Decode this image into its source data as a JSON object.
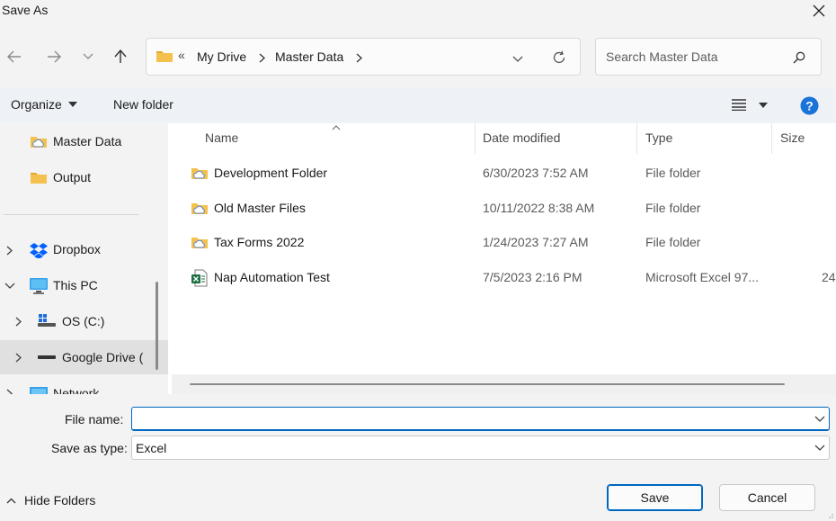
{
  "window": {
    "title": "Save As"
  },
  "address": {
    "crumbs": [
      "My Drive",
      "Master Data"
    ],
    "overflow": "«"
  },
  "search": {
    "placeholder": "Search Master Data"
  },
  "toolbar": {
    "organize_label": "Organize",
    "new_folder_label": "New folder"
  },
  "tree": {
    "items": [
      {
        "label": "Master Data"
      },
      {
        "label": "Output"
      },
      {
        "label": "Dropbox"
      },
      {
        "label": "This PC"
      },
      {
        "label": "OS (C:)"
      },
      {
        "label": "Google Drive ("
      },
      {
        "label": "Network"
      }
    ]
  },
  "files": {
    "columns": [
      "Name",
      "Date modified",
      "Type",
      "Size"
    ],
    "rows": [
      {
        "name": "Development Folder",
        "date": "6/30/2023 7:52 AM",
        "type": "File folder",
        "size": "",
        "icon": "folder-cloud-icon"
      },
      {
        "name": "Old Master Files",
        "date": "10/11/2022 8:38 AM",
        "type": "File folder",
        "size": "",
        "icon": "folder-cloud-icon"
      },
      {
        "name": "Tax Forms 2022",
        "date": "1/24/2023 7:27 AM",
        "type": "File folder",
        "size": "",
        "icon": "folder-cloud-icon"
      },
      {
        "name": "Nap Automation Test",
        "date": "7/5/2023 2:16 PM",
        "type": "Microsoft Excel 97...",
        "size": "24",
        "icon": "excel-file-icon"
      }
    ]
  },
  "form": {
    "file_name_label": "File name:",
    "file_name_value": "",
    "save_type_label": "Save as type:",
    "save_type_value": "Excel"
  },
  "footer": {
    "hide_folders_label": "Hide Folders",
    "save_label": "Save",
    "cancel_label": "Cancel"
  },
  "colors": {
    "accent": "#0067c0",
    "folder": "#f4c04e",
    "help": "#1a73d9"
  }
}
